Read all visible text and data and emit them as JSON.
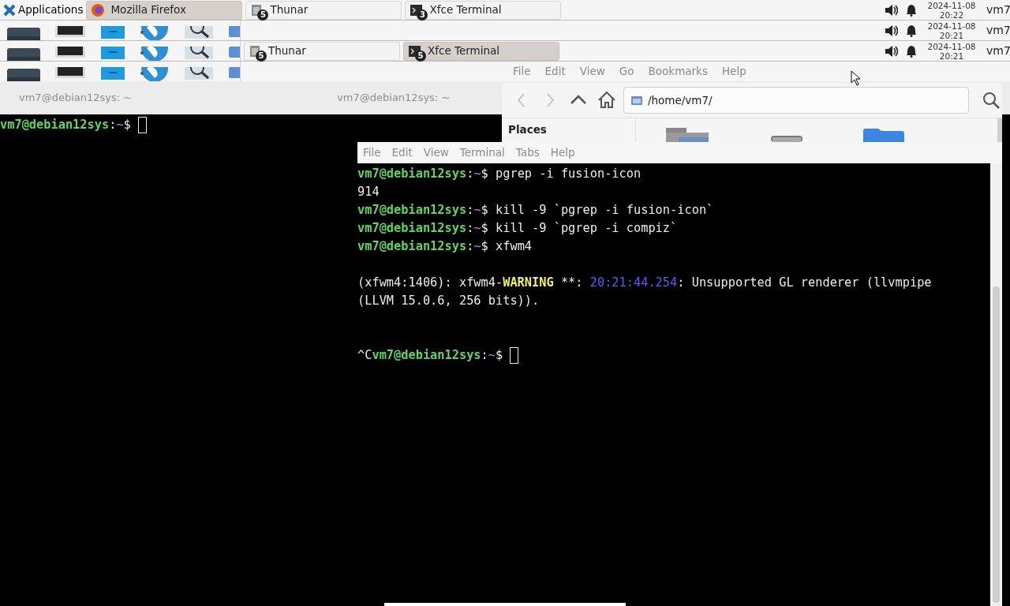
{
  "panels": [
    {
      "start": {
        "kind": "applications",
        "label": "Applications"
      },
      "tasks": [
        {
          "kind": "browser",
          "label": "Mozilla Firefox",
          "selected": true
        },
        {
          "kind": "files",
          "label": "Thunar",
          "badge": "5",
          "selected": false
        },
        {
          "kind": "terminal",
          "label": "Xfce Terminal",
          "badge": "3",
          "selected": false
        }
      ],
      "tray": {
        "date": "2024-11-08",
        "time": "20:22",
        "user": "vm7"
      }
    },
    {
      "start": {
        "kind": "launchers"
      },
      "tray": {
        "date": "2024-11-08",
        "time": "20:21",
        "user": "vm7"
      }
    },
    {
      "start": {
        "kind": "launchers"
      },
      "tasks": [
        {
          "kind": "files",
          "label": "Thunar",
          "badge": "5",
          "selected": false
        },
        {
          "kind": "terminal",
          "label": "Xfce Terminal",
          "badge": "5",
          "selected": true
        }
      ],
      "tray": {
        "date": "2024-11-08",
        "time": "20:21",
        "user": "vm7"
      }
    },
    {
      "start": {
        "kind": "launchers"
      }
    }
  ],
  "back_terminal": {
    "titles": [
      "vm7@debian12sys: ~",
      "vm7@debian12sys: ~"
    ],
    "lines": [
      {
        "segments": [
          {
            "kind": "user",
            "text": "vm7@debian12sys"
          },
          {
            "kind": "plain",
            "text": ":"
          },
          {
            "kind": "path",
            "text": "~"
          },
          {
            "kind": "plain",
            "text": "$ "
          }
        ],
        "cursor": true
      }
    ]
  },
  "thunar": {
    "menu": [
      "File",
      "Edit",
      "View",
      "Go",
      "Bookmarks",
      "Help"
    ],
    "nav": [
      {
        "kind": "back",
        "disabled": true
      },
      {
        "kind": "forward",
        "disabled": true
      },
      {
        "kind": "up",
        "disabled": false
      },
      {
        "kind": "home",
        "disabled": false
      }
    ],
    "location": "/home/vm7/",
    "sidebar_heading": "Places"
  },
  "terminal": {
    "menu": [
      "File",
      "Edit",
      "View",
      "Terminal",
      "Tabs",
      "Help"
    ],
    "lines": [
      {
        "segments": [
          {
            "kind": "user",
            "text": "vm7@debian12sys"
          },
          {
            "kind": "plain",
            "text": ":"
          },
          {
            "kind": "path",
            "text": "~"
          },
          {
            "kind": "plain",
            "text": "$ pgrep -i fusion-icon"
          }
        ]
      },
      {
        "segments": [
          {
            "kind": "plain",
            "text": "914"
          }
        ]
      },
      {
        "segments": [
          {
            "kind": "user",
            "text": "vm7@debian12sys"
          },
          {
            "kind": "plain",
            "text": ":"
          },
          {
            "kind": "path",
            "text": "~"
          },
          {
            "kind": "plain",
            "text": "$ kill -9 `pgrep -i fusion-icon`"
          }
        ]
      },
      {
        "segments": [
          {
            "kind": "user",
            "text": "vm7@debian12sys"
          },
          {
            "kind": "plain",
            "text": ":"
          },
          {
            "kind": "path",
            "text": "~"
          },
          {
            "kind": "plain",
            "text": "$ kill -9 `pgrep -i compiz`"
          }
        ]
      },
      {
        "segments": [
          {
            "kind": "user",
            "text": "vm7@debian12sys"
          },
          {
            "kind": "plain",
            "text": ":"
          },
          {
            "kind": "path",
            "text": "~"
          },
          {
            "kind": "plain",
            "text": "$ xfwm4"
          }
        ]
      },
      {
        "kind": "blank"
      },
      {
        "segments": [
          {
            "kind": "plain",
            "text": "(xfwm4:1406): xfwm4-"
          },
          {
            "kind": "warning",
            "text": "WARNING"
          },
          {
            "kind": "plain",
            "text": " **: "
          },
          {
            "kind": "timestamp",
            "text": "20:21:44.254"
          },
          {
            "kind": "plain",
            "text": ": Unsupported GL renderer (llvmpipe"
          }
        ]
      },
      {
        "segments": [
          {
            "kind": "plain",
            "text": "(LLVM 15.0.6, 256 bits))."
          }
        ]
      },
      {
        "kind": "blank"
      },
      {
        "kind": "blank"
      },
      {
        "segments": [
          {
            "kind": "plain",
            "text": "^C"
          },
          {
            "kind": "user",
            "text": "vm7@debian12sys"
          },
          {
            "kind": "plain",
            "text": ":"
          },
          {
            "kind": "path",
            "text": "~"
          },
          {
            "kind": "plain",
            "text": "$ "
          }
        ],
        "cursor": true
      }
    ]
  }
}
